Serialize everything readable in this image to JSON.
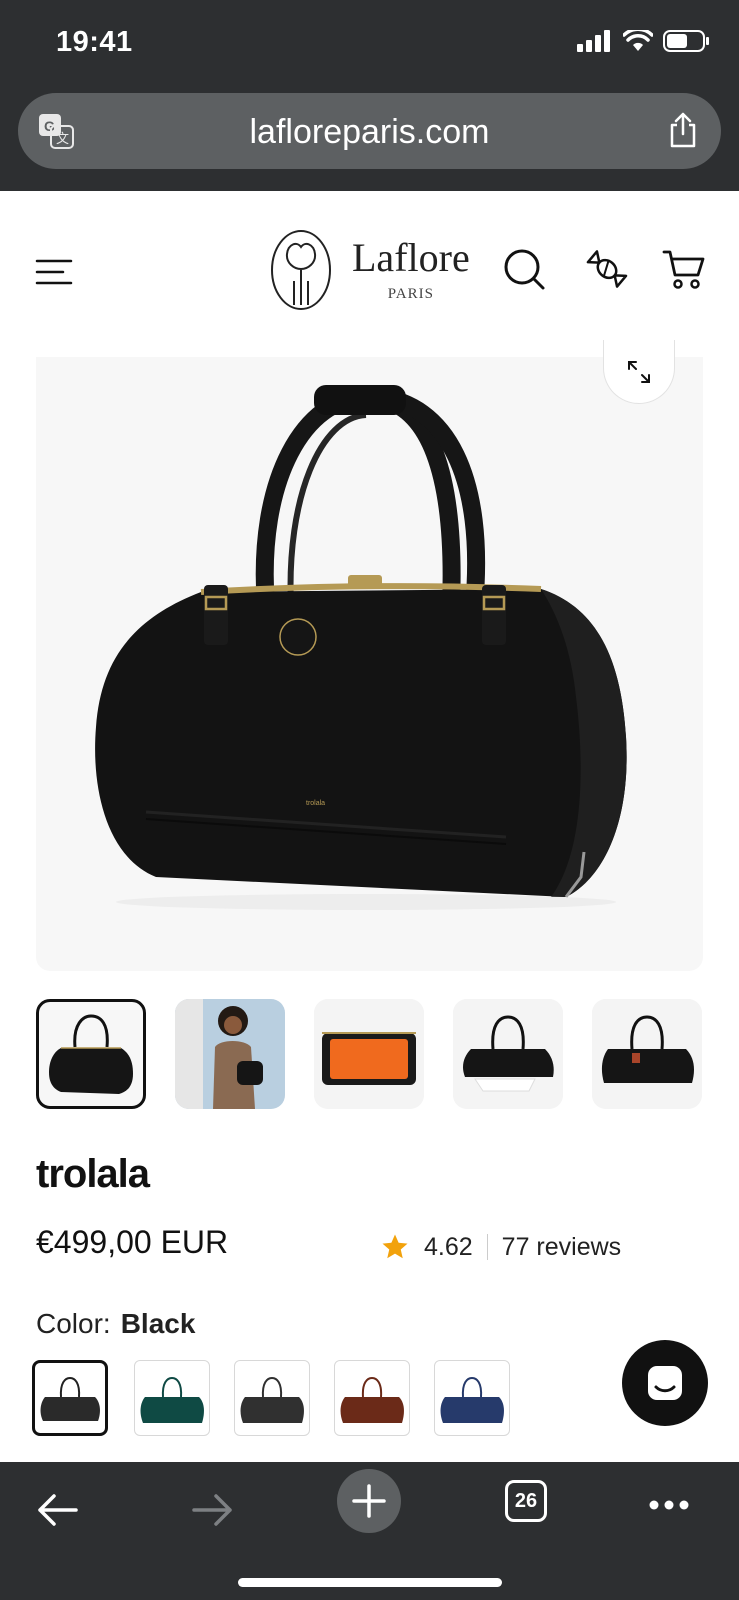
{
  "status_bar": {
    "time": "19:41"
  },
  "browser": {
    "url": "lafloreparis.com",
    "tabs_count": "26"
  },
  "header": {
    "brand_name": "Laflore",
    "brand_sub": "PARIS"
  },
  "product": {
    "title": "trolala",
    "price": "€499,00 EUR",
    "rating": "4.62",
    "reviews": "77 reviews",
    "color_label": "Color:",
    "color_value": "Black"
  },
  "thumbnails": [
    "bag-front",
    "model-photo",
    "interior-orange",
    "bag-open",
    "bag-side"
  ],
  "swatches": [
    {
      "name": "black",
      "color": "#2a2a2a"
    },
    {
      "name": "green",
      "color": "#0f4a44"
    },
    {
      "name": "black-2",
      "color": "#303030"
    },
    {
      "name": "brown",
      "color": "#6b2a18"
    },
    {
      "name": "navy",
      "color": "#263a6b"
    }
  ],
  "colors": {
    "chrome": "#2d2f31",
    "accent_star": "#f2a20c"
  }
}
